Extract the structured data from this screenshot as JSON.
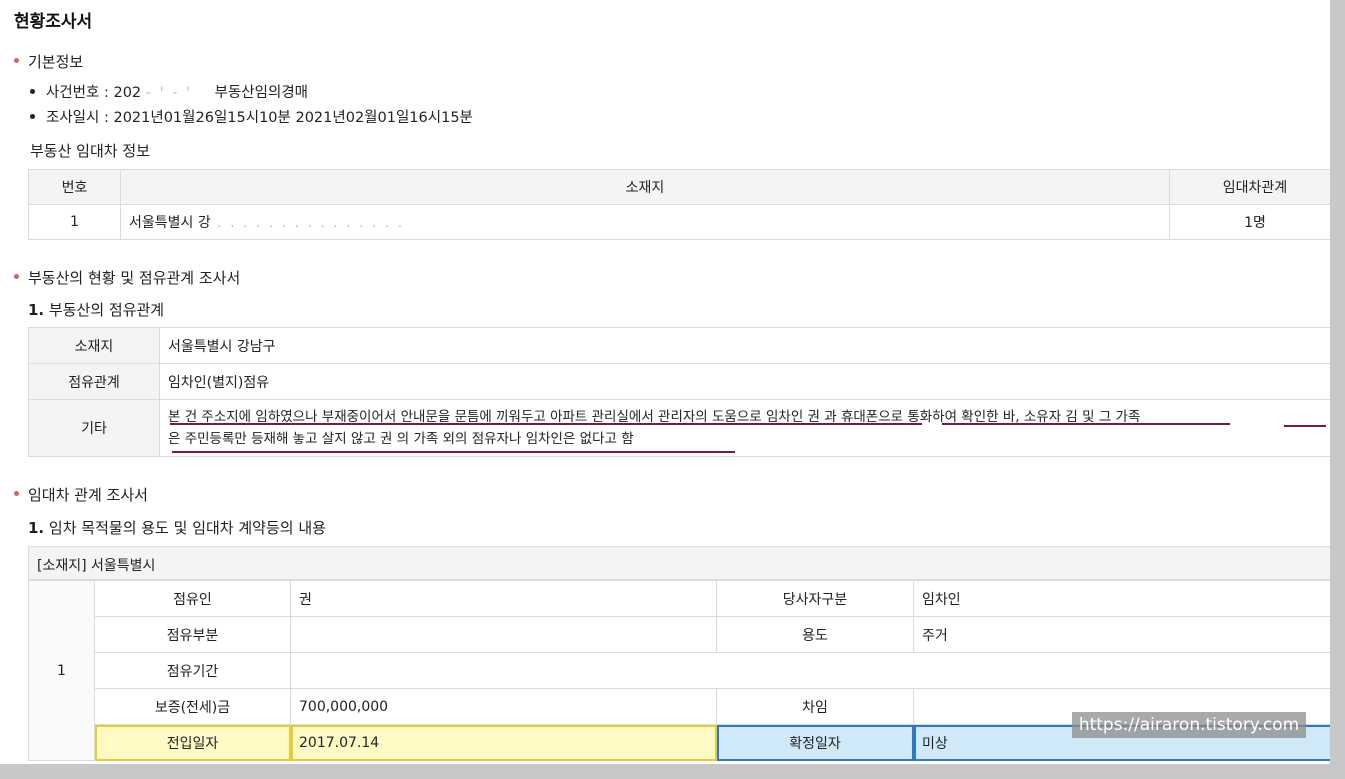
{
  "title": "현황조사서",
  "basic": {
    "heading": "기본정보",
    "case_label": "사건번호 : 202",
    "case_masked": "- ' - '",
    "case_type": "부동산임의경매",
    "survey_date": "조사일시 : 2021년01월26일15시10분  2021년02월01일16시15분"
  },
  "lease_info": {
    "heading": "부동산 임대차 정보",
    "headers": [
      "번호",
      "소재지",
      "임대차관계"
    ],
    "row": {
      "no": "1",
      "address": "서울특별시 강",
      "relation": "1명"
    }
  },
  "occupancy_section": {
    "heading": "부동산의 현황 및 점유관계 조사서",
    "sub_num": "1.",
    "sub_title": "부동산의 점유관계",
    "rows": [
      {
        "label": "소재지",
        "value": "서울특별시 강남구"
      },
      {
        "label": "점유관계",
        "value": "임차인(별지)점유"
      },
      {
        "label": "기타",
        "value_line1": "본 건 주소지에 임하였으나 부재중이어서 안내문을 문틈에 끼워두고 아파트 관리실에서 관리자의 도움으로 임차인 권    과 휴대폰으로 통화하여 확인한 바, 소유자 김    및 그 가족",
        "value_line2": "은 주민등록만 등재해 놓고 살지 않고 권    의 가족 외의 점유자나 임차인은 없다고 함"
      }
    ]
  },
  "lease_section": {
    "heading": "임대차 관계 조사서",
    "sub_num": "1.",
    "sub_title": "임차 목적물의 용도 및 임대차 계약등의 내용",
    "address_bar": "[소재지] 서울특별시",
    "row_no": "1",
    "rows": [
      {
        "l1": "점유인",
        "v1": "권",
        "l2": "당사자구분",
        "v2": "임차인"
      },
      {
        "l1": "점유부분",
        "v1": "",
        "l2": "용도",
        "v2": "주거"
      },
      {
        "l1": "점유기간",
        "v1": ""
      },
      {
        "l1": "보증(전세)금",
        "v1": "700,000,000",
        "l2": "차임",
        "v2": ""
      },
      {
        "l1": "전입일자",
        "v1": "2017.07.14",
        "l2": "확정일자",
        "v2": "미상"
      }
    ]
  },
  "watermark": "https://airaron.tistory.com",
  "colors": {
    "bullet_red": "#e05a5a",
    "underline": "#7a1c2e",
    "highlight_yellow": "#fff9c4",
    "highlight_blue": "#cfe9f8"
  }
}
